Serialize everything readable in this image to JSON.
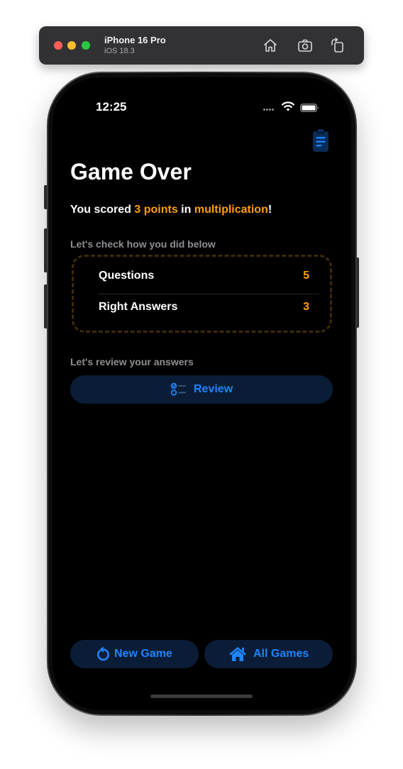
{
  "simulator": {
    "device_name": "iPhone 16 Pro",
    "os_version": "iOS 18.3",
    "toolbar_icons": [
      "home-icon",
      "screenshot-camera-icon",
      "rotate-icon"
    ]
  },
  "status_bar": {
    "time": "12:25",
    "icons": [
      "signal-dots-icon",
      "wifi-icon",
      "battery-icon"
    ]
  },
  "header": {
    "action_icon": "clipboard-icon",
    "title": "Game Over"
  },
  "score": {
    "prefix": "You scored ",
    "points": "3 points",
    "middle": " in ",
    "subject": "multiplication",
    "suffix": "!"
  },
  "summary": {
    "caption": "Let's check how you did below",
    "rows": [
      {
        "label": "Questions",
        "value": "5"
      },
      {
        "label": "Right Answers",
        "value": "3"
      }
    ]
  },
  "review": {
    "caption": "Let's review your answers",
    "button_label": "Review",
    "button_icon": "checklist-icon"
  },
  "footer": {
    "new_game_label": "New Game",
    "new_game_icon": "restart-arrow-icon",
    "all_games_label": "All Games",
    "all_games_icon": "house-icon"
  },
  "colors": {
    "accent_orange": "#ff9f0a",
    "accent_blue": "#1e84ff",
    "button_bg": "#0b1d36",
    "screen_bg": "#000000"
  }
}
